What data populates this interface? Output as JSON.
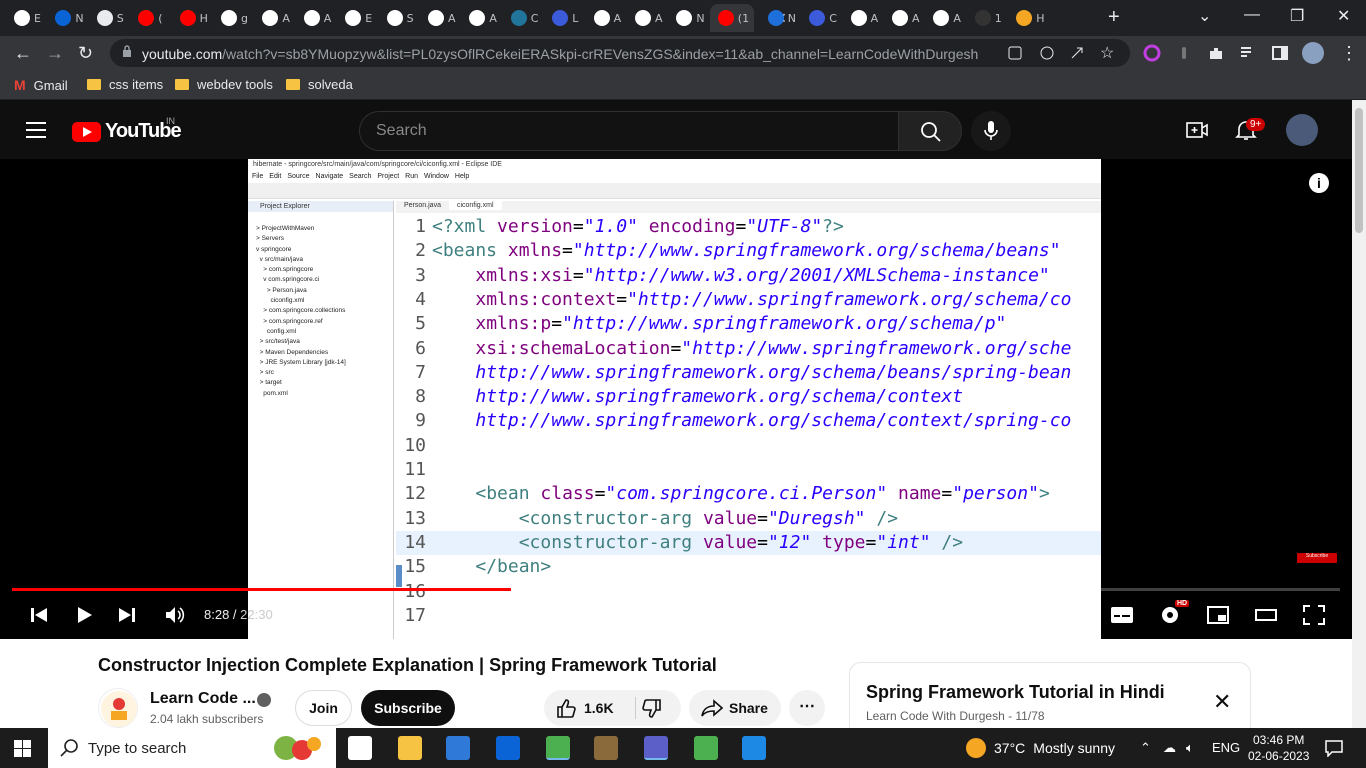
{
  "browser": {
    "tabs": [
      {
        "favicon": "info-icon",
        "label": "E",
        "color": "#ffffff"
      },
      {
        "favicon": "outlook-icon",
        "label": "N",
        "color": "#0a64d6"
      },
      {
        "favicon": "github-icon",
        "label": "S",
        "color": "#e8eaed"
      },
      {
        "favicon": "youtube-icon",
        "label": "(",
        "color": "#ff0000"
      },
      {
        "favicon": "youtube-icon",
        "label": "H",
        "color": "#ff0000"
      },
      {
        "favicon": "chatgpt-icon",
        "label": "g",
        "color": "#ffffff"
      },
      {
        "favicon": "chatgpt-icon",
        "label": "A",
        "color": "#ffffff"
      },
      {
        "favicon": "chatgpt-icon",
        "label": "A",
        "color": "#ffffff"
      },
      {
        "favicon": "chatgpt-icon",
        "label": "E",
        "color": "#ffffff"
      },
      {
        "favicon": "chatgpt-icon",
        "label": "S",
        "color": "#ffffff"
      },
      {
        "favicon": "chatgpt-icon",
        "label": "A",
        "color": "#ffffff"
      },
      {
        "favicon": "chatgpt-icon",
        "label": "A",
        "color": "#ffffff"
      },
      {
        "favicon": "wordpress-icon",
        "label": "C",
        "color": "#21759b"
      },
      {
        "favicon": "linear-icon",
        "label": "L",
        "color": "#3b5bdb"
      },
      {
        "favicon": "chatgpt-icon",
        "label": "A",
        "color": "#ffffff"
      },
      {
        "favicon": "chatgpt-icon",
        "label": "A",
        "color": "#ffffff"
      },
      {
        "favicon": "chatgpt-icon",
        "label": "N",
        "color": "#ffffff"
      },
      {
        "favicon": "youtube-icon",
        "label": "(1",
        "color": "#ff0000"
      },
      {
        "favicon": "msn-icon",
        "label": "N",
        "color": "#1e6fd9"
      },
      {
        "favicon": "linear-icon",
        "label": "C",
        "color": "#3b5bdb"
      },
      {
        "favicon": "chatgpt-icon",
        "label": "A",
        "color": "#ffffff"
      },
      {
        "favicon": "chatgpt-icon",
        "label": "A",
        "color": "#ffffff"
      },
      {
        "favicon": "chatgpt-icon",
        "label": "A",
        "color": "#ffffff"
      },
      {
        "favicon": "app-icon",
        "label": "1",
        "color": "#333333"
      },
      {
        "favicon": "app-icon",
        "label": "H",
        "color": "#f5a623"
      }
    ],
    "active_tab_index": 17,
    "url_host": "youtube.com",
    "url_path": "/watch?v=sb8YMuopzyw&list=PL0zysOflRCekeiERASkpi-crREVensZGS&index=11&ab_channel=LearnCodeWithDurgesh",
    "bookmarks": [
      {
        "label": "Gmail",
        "icon": "gmail-icon"
      },
      {
        "label": "css items",
        "icon": "folder-icon"
      },
      {
        "label": "webdev tools",
        "icon": "folder-icon"
      },
      {
        "label": "solveda",
        "icon": "folder-icon"
      }
    ]
  },
  "youtube": {
    "logo_text": "YouTube",
    "country": "IN",
    "search_placeholder": "Search",
    "notifications_badge": "9+"
  },
  "video": {
    "ide": {
      "window_title": "hibernate - springcore/src/main/java/com/springcore/ci/ciconfig.xml - Eclipse IDE",
      "menu": [
        "File",
        "Edit",
        "Source",
        "Navigate",
        "Search",
        "Project",
        "Run",
        "Window",
        "Help"
      ],
      "explorer_title": "Project Explorer",
      "tree": [
        "> ProjectWithMaven",
        "> Servers",
        "v springcore",
        "  v src/main/java",
        "    > com.springcore",
        "    v com.springcore.ci",
        "      > Person.java",
        "        ciconfig.xml",
        "    > com.springcore.collections",
        "    > com.springcore.ref",
        "      config.xml",
        "  > src/test/java",
        "  > Maven Dependencies",
        "  > JRE System Library [jdk-14]",
        "  > src",
        "  > target",
        "    pom.xml"
      ],
      "editor_tabs": [
        "Person.java",
        "ciconfig.xml"
      ],
      "code_lines": [
        {
          "n": "1",
          "parts": [
            [
              "pi",
              "<?xml "
            ],
            [
              "attr",
              "version"
            ],
            [
              "plain",
              "="
            ],
            [
              "val",
              "\"1.0\""
            ],
            [
              "plain",
              " "
            ],
            [
              "attr",
              "encoding"
            ],
            [
              "plain",
              "="
            ],
            [
              "val",
              "\"UTF-8\""
            ],
            [
              "pi",
              "?>"
            ]
          ]
        },
        {
          "n": "2",
          "parts": [
            [
              "tag",
              "<beans "
            ],
            [
              "attr",
              "xmlns"
            ],
            [
              "plain",
              "="
            ],
            [
              "val",
              "\"http://www.springframework.org/schema/beans\""
            ]
          ]
        },
        {
          "n": "3",
          "parts": [
            [
              "plain",
              "    "
            ],
            [
              "attr",
              "xmlns:xsi"
            ],
            [
              "plain",
              "="
            ],
            [
              "val",
              "\"http://www.w3.org/2001/XMLSchema-instance\""
            ]
          ]
        },
        {
          "n": "4",
          "parts": [
            [
              "plain",
              "    "
            ],
            [
              "attr",
              "xmlns:context"
            ],
            [
              "plain",
              "="
            ],
            [
              "val",
              "\"http://www.springframework.org/schema/co"
            ]
          ]
        },
        {
          "n": "5",
          "parts": [
            [
              "plain",
              "    "
            ],
            [
              "attr",
              "xmlns:p"
            ],
            [
              "plain",
              "="
            ],
            [
              "val",
              "\"http://www.springframework.org/schema/p\""
            ]
          ]
        },
        {
          "n": "6",
          "parts": [
            [
              "plain",
              "    "
            ],
            [
              "attr",
              "xsi:schemaLocation"
            ],
            [
              "plain",
              "="
            ],
            [
              "val",
              "\"http://www.springframework.org/sche"
            ]
          ]
        },
        {
          "n": "7",
          "parts": [
            [
              "plain",
              "    "
            ],
            [
              "val",
              "http://www.springframework.org/schema/beans/spring-bean"
            ]
          ]
        },
        {
          "n": "8",
          "parts": [
            [
              "plain",
              "    "
            ],
            [
              "val",
              "http://www.springframework.org/schema/context"
            ]
          ]
        },
        {
          "n": "9",
          "parts": [
            [
              "plain",
              "    "
            ],
            [
              "val",
              "http://www.springframework.org/schema/context/spring-co"
            ]
          ]
        },
        {
          "n": "10",
          "parts": []
        },
        {
          "n": "11",
          "parts": []
        },
        {
          "n": "12",
          "parts": [
            [
              "plain",
              "    "
            ],
            [
              "tag",
              "<bean "
            ],
            [
              "attr",
              "class"
            ],
            [
              "plain",
              "="
            ],
            [
              "val",
              "\"com.springcore.ci.Person\""
            ],
            [
              "plain",
              " "
            ],
            [
              "attr",
              "name"
            ],
            [
              "plain",
              "="
            ],
            [
              "val",
              "\"person\""
            ],
            [
              "tag",
              ">"
            ]
          ]
        },
        {
          "n": "13",
          "parts": [
            [
              "plain",
              "        "
            ],
            [
              "tag",
              "<constructor-arg "
            ],
            [
              "attr",
              "value"
            ],
            [
              "plain",
              "="
            ],
            [
              "val",
              "\"Duregsh\""
            ],
            [
              "plain",
              " "
            ],
            [
              "tag",
              "/>"
            ]
          ]
        },
        {
          "n": "14",
          "parts": [
            [
              "plain",
              "        "
            ],
            [
              "tag",
              "<constructor-arg "
            ],
            [
              "attr",
              "value"
            ],
            [
              "plain",
              "="
            ],
            [
              "val",
              "\"12\""
            ],
            [
              "plain",
              " "
            ],
            [
              "attr",
              "type"
            ],
            [
              "plain",
              "="
            ],
            [
              "val",
              "\"int\""
            ],
            [
              "plain",
              " "
            ],
            [
              "tag",
              "/>"
            ]
          ]
        },
        {
          "n": "15",
          "parts": [
            [
              "plain",
              "    "
            ],
            [
              "tag",
              "</bean>"
            ]
          ]
        },
        {
          "n": "16",
          "parts": []
        },
        {
          "n": "17",
          "parts": []
        }
      ],
      "highlighted_line": "14"
    },
    "subscribe_watermark": "Subscribe",
    "current_time": "8:28",
    "duration": "22:30",
    "played_fraction": 0.376,
    "buffered_fraction": 0.469,
    "hd_badge": "HD"
  },
  "details": {
    "title": "Constructor Injection Complete Explanation | Spring Framework Tutorial",
    "channel_name": "Learn Code ...",
    "subscribers": "2.04 lakh subscribers",
    "join_label": "Join",
    "subscribe_label": "Subscribe",
    "likes": "1.6K",
    "share_label": "Share"
  },
  "playlist": {
    "title": "Spring Framework Tutorial in Hindi",
    "subtitle": "Learn Code With Durgesh - 11/78"
  },
  "taskbar": {
    "search_placeholder": "Type to search",
    "weather_temp": "37°C",
    "weather_desc": "Mostly sunny",
    "language": "ENG",
    "time": "03:46 PM",
    "date": "02-06-2023",
    "apps": [
      {
        "name": "task-view-icon",
        "color": "#ffffff"
      },
      {
        "name": "file-explorer-icon",
        "color": "#f6c343"
      },
      {
        "name": "microsoft-store-icon",
        "color": "#2f7ad8"
      },
      {
        "name": "outlook-icon",
        "color": "#0a64d6"
      },
      {
        "name": "chrome-icon",
        "color": "#4caf50"
      },
      {
        "name": "game-icon",
        "color": "#8a6a3a"
      },
      {
        "name": "teams-icon",
        "color": "#5b5fc7"
      },
      {
        "name": "remote-desktop-icon",
        "color": "#4caf50"
      },
      {
        "name": "photos-icon",
        "color": "#1e88e5"
      }
    ]
  }
}
